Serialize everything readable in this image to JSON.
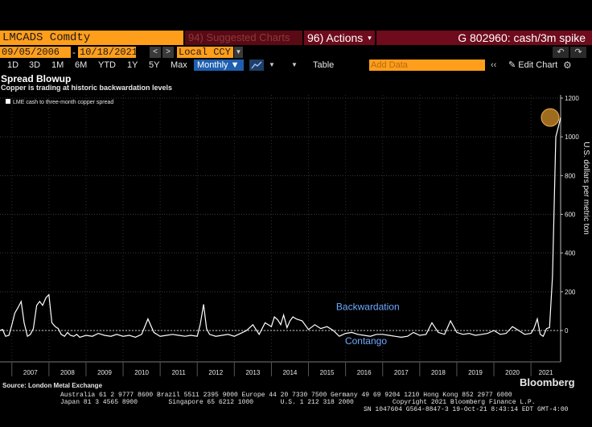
{
  "header": {
    "ticker": "LMCADS Comdty",
    "suggested": "94) Suggested Charts",
    "actions": "96) Actions",
    "actions_caret": "▾",
    "graph_title": "G 802960: cash/3m spike"
  },
  "range": {
    "start": "09/05/2006",
    "end": "10/18/2021",
    "dash": "-",
    "currency": "Local CCY"
  },
  "periods": [
    "1D",
    "3D",
    "1M",
    "6M",
    "YTD",
    "1Y",
    "5Y",
    "Max"
  ],
  "frequency": "Monthly",
  "toolbar": {
    "table": "Table",
    "add_data_placeholder": "Add Data",
    "edit_chart": "Edit Chart"
  },
  "chart_data": {
    "type": "line",
    "title": "Spread Blowup",
    "subtitle": "Copper is trading at historic backwardation levels",
    "legend": [
      "LME cash to three-month copper spread"
    ],
    "legend_position": "top-left",
    "ylabel": "U.S. dollars per metric ton",
    "ylim": [
      -150,
      1200
    ],
    "yticks": [
      0,
      200,
      400,
      600,
      800,
      1000,
      1200
    ],
    "xticks": [
      "2007",
      "2008",
      "2009",
      "2010",
      "2011",
      "2012",
      "2013",
      "2014",
      "2015",
      "2016",
      "2017",
      "2018",
      "2019",
      "2020",
      "2021"
    ],
    "xlim": [
      2006.68,
      2021.8
    ],
    "grid": true,
    "series": [
      {
        "name": "LME cash to three-month copper spread",
        "color": "#ffffff",
        "x": [
          2006.68,
          2006.75,
          2006.83,
          2006.92,
          2007.0,
          2007.08,
          2007.17,
          2007.25,
          2007.33,
          2007.42,
          2007.5,
          2007.58,
          2007.67,
          2007.75,
          2007.83,
          2007.92,
          2008.0,
          2008.08,
          2008.17,
          2008.25,
          2008.33,
          2008.42,
          2008.5,
          2008.58,
          2008.67,
          2008.75,
          2008.83,
          2008.92,
          2009.0,
          2009.17,
          2009.33,
          2009.5,
          2009.67,
          2009.83,
          2010.0,
          2010.17,
          2010.33,
          2010.5,
          2010.67,
          2010.83,
          2011.0,
          2011.17,
          2011.33,
          2011.5,
          2011.67,
          2011.83,
          2012.0,
          2012.08,
          2012.17,
          2012.25,
          2012.33,
          2012.5,
          2012.67,
          2012.83,
          2013.0,
          2013.17,
          2013.33,
          2013.5,
          2013.67,
          2013.83,
          2014.0,
          2014.08,
          2014.17,
          2014.25,
          2014.33,
          2014.42,
          2014.5,
          2014.58,
          2014.67,
          2014.83,
          2015.0,
          2015.17,
          2015.33,
          2015.5,
          2015.67,
          2015.83,
          2016.0,
          2016.17,
          2016.33,
          2016.5,
          2016.67,
          2016.83,
          2017.0,
          2017.17,
          2017.33,
          2017.5,
          2017.67,
          2017.83,
          2018.0,
          2018.17,
          2018.33,
          2018.5,
          2018.67,
          2018.83,
          2019.0,
          2019.17,
          2019.33,
          2019.5,
          2019.67,
          2019.83,
          2020.0,
          2020.17,
          2020.33,
          2020.5,
          2020.67,
          2020.83,
          2021.0,
          2021.08,
          2021.17,
          2021.25,
          2021.33,
          2021.42,
          2021.5,
          2021.58,
          2021.67,
          2021.75,
          2021.8
        ],
        "y": [
          0,
          5,
          -30,
          -25,
          30,
          90,
          120,
          150,
          40,
          -30,
          -20,
          10,
          130,
          150,
          130,
          170,
          185,
          40,
          20,
          10,
          -20,
          -30,
          -10,
          -25,
          -30,
          -20,
          -35,
          -30,
          -25,
          -30,
          -15,
          -25,
          -30,
          -20,
          -30,
          -25,
          -35,
          -20,
          60,
          -10,
          -30,
          -25,
          -20,
          -25,
          -30,
          -25,
          -30,
          30,
          135,
          10,
          -20,
          -30,
          -25,
          -20,
          -30,
          -15,
          0,
          30,
          -20,
          40,
          20,
          70,
          55,
          30,
          80,
          15,
          50,
          70,
          60,
          50,
          5,
          30,
          10,
          20,
          0,
          -30,
          -15,
          -10,
          -20,
          -25,
          -30,
          -20,
          -20,
          -25,
          -30,
          -35,
          -30,
          -10,
          -25,
          -20,
          40,
          -10,
          -20,
          50,
          -10,
          -20,
          -15,
          -25,
          -20,
          -15,
          0,
          -20,
          -15,
          20,
          0,
          -20,
          -15,
          10,
          60,
          -20,
          -30,
          10,
          15,
          280,
          1000,
          1060,
          1100
        ]
      }
    ],
    "highlight": {
      "x": 2021.8,
      "y": 1100,
      "color": "#d4902a"
    },
    "annotations": [
      {
        "text": "Backwardation",
        "x": 2016.6,
        "y": 105,
        "color": "#6fa8ff"
      },
      {
        "text": "Contango",
        "x": 2016.55,
        "y": -70,
        "color": "#6fa8ff"
      }
    ],
    "reference_line_y": 0
  },
  "footer": {
    "source": "Source: London Metal Exchange",
    "brand": "Bloomberg",
    "line1": "Australia 61 2 9777 8600 Brazil 5511 2395 9000 Europe 44 20 7330 7500 Germany 49 69 9204 1210 Hong Kong 852 2977 6000",
    "line2": "Japan 81 3 4565 8900        Singapore 65 6212 1000       U.S. 1 212 318 2000          Copyright 2021 Bloomberg Finance L.P.",
    "line3": "SN 1047604 G564-8847-3 19-Oct-21  8:43:14 EDT  GMT-4:00"
  }
}
